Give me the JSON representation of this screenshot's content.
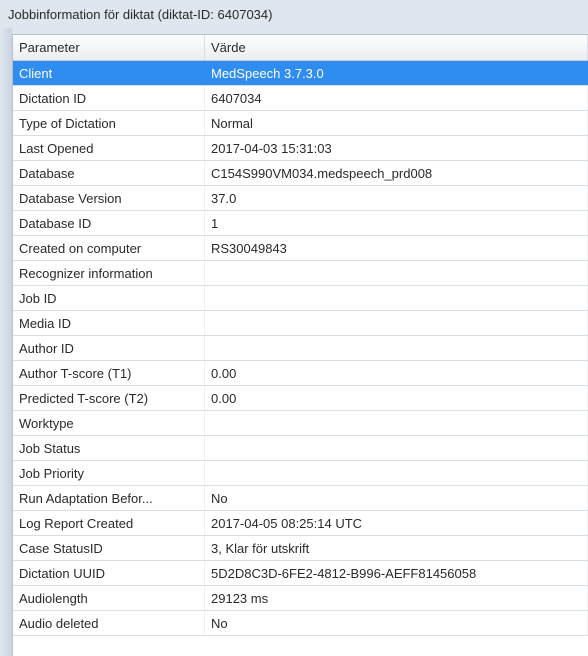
{
  "window": {
    "title": "Jobbinformation för diktat (diktat-ID: 6407034)"
  },
  "table": {
    "headers": {
      "parameter": "Parameter",
      "value": "Värde"
    },
    "rows": [
      {
        "param": "Client",
        "value": "MedSpeech 3.7.3.0",
        "selected": true
      },
      {
        "param": "Dictation ID",
        "value": "6407034"
      },
      {
        "param": "Type of Dictation",
        "value": "Normal"
      },
      {
        "param": "Last Opened",
        "value": "2017-04-03 15:31:03"
      },
      {
        "param": "Database",
        "value": "C154S990VM034.medspeech_prd008"
      },
      {
        "param": "Database Version",
        "value": "37.0"
      },
      {
        "param": "Database ID",
        "value": "1"
      },
      {
        "param": "Created on computer",
        "value": "RS30049843"
      },
      {
        "param": "Recognizer information",
        "value": ""
      },
      {
        "param": "Job ID",
        "value": ""
      },
      {
        "param": "Media ID",
        "value": ""
      },
      {
        "param": "Author ID",
        "value": ""
      },
      {
        "param": "Author T-score (T1)",
        "value": "0.00"
      },
      {
        "param": "Predicted T-score (T2)",
        "value": "0.00"
      },
      {
        "param": "Worktype",
        "value": ""
      },
      {
        "param": "Job Status",
        "value": ""
      },
      {
        "param": "Job Priority",
        "value": ""
      },
      {
        "param": "Run Adaptation Befor...",
        "value": "No"
      },
      {
        "param": "Log Report Created",
        "value": "2017-04-05 08:25:14 UTC"
      },
      {
        "param": "Case StatusID",
        "value": "3, Klar för utskrift"
      },
      {
        "param": "Dictation UUID",
        "value": "5D2D8C3D-6FE2-4812-B996-AEFF81456058"
      },
      {
        "param": "Audiolength",
        "value": "29123 ms"
      },
      {
        "param": "Audio deleted",
        "value": "No"
      }
    ]
  }
}
